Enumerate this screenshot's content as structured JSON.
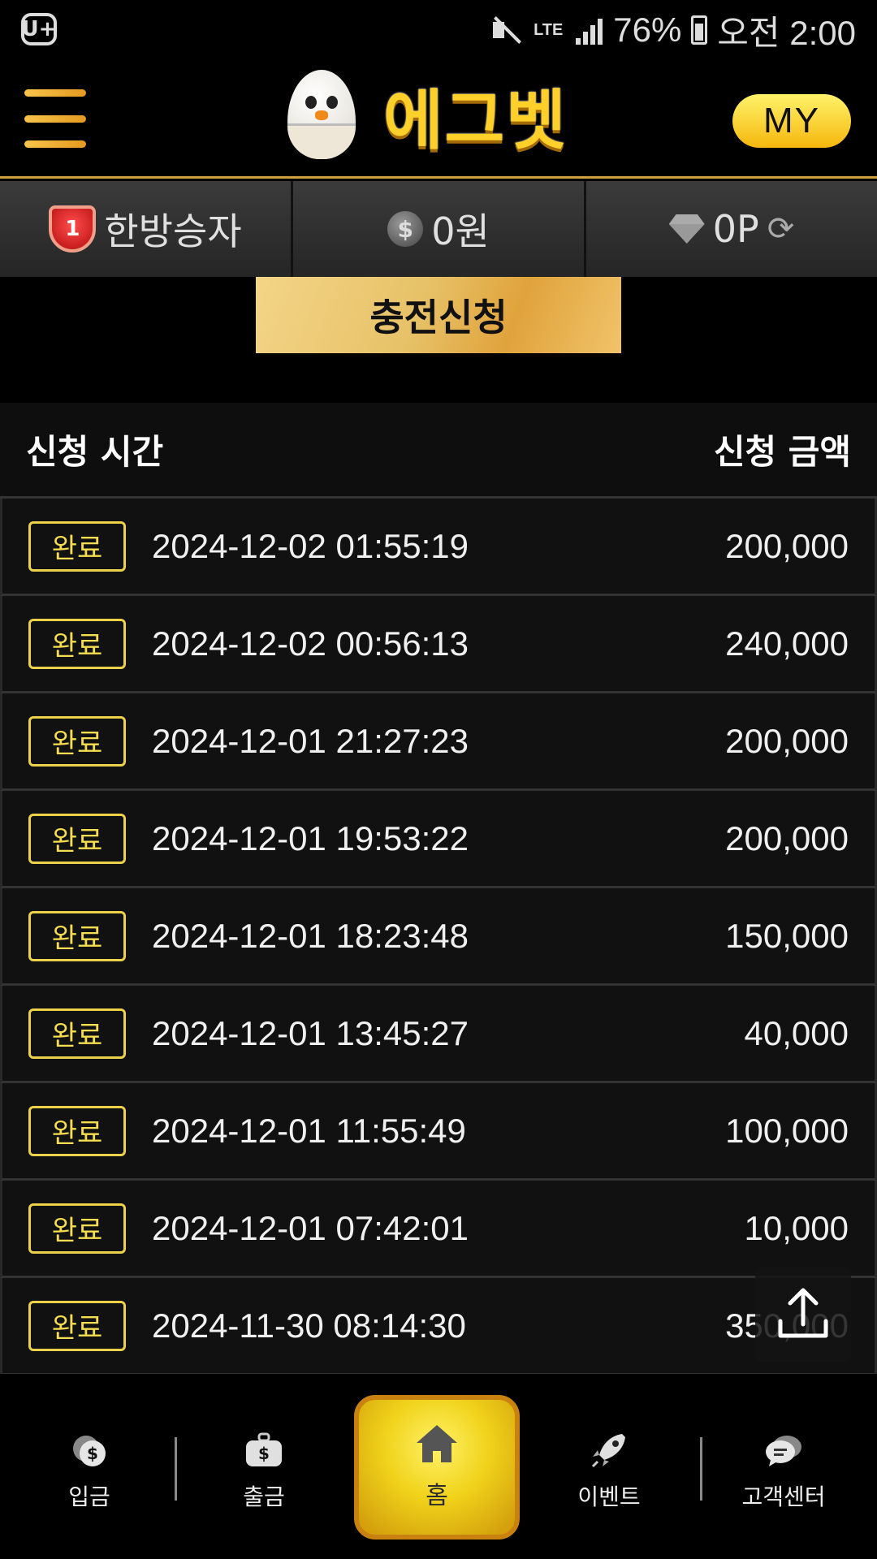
{
  "status_bar": {
    "carrier_icon": "U+",
    "network": "LTE",
    "battery": "76%",
    "time": "오전 2:00"
  },
  "header": {
    "logo_text": "에그벳",
    "my_button_label": "MY"
  },
  "info_bar": {
    "level": "1",
    "username": "한방승자",
    "balance": "0원",
    "points": "0P"
  },
  "charge_button_label": "충전신청",
  "table": {
    "col_time": "신청 시간",
    "col_amount": "신청 금액",
    "rows": [
      {
        "status": "완료",
        "time": "2024-12-02 01:55:19",
        "amount": "200,000"
      },
      {
        "status": "완료",
        "time": "2024-12-02 00:56:13",
        "amount": "240,000"
      },
      {
        "status": "완료",
        "time": "2024-12-01 21:27:23",
        "amount": "200,000"
      },
      {
        "status": "완료",
        "time": "2024-12-01 19:53:22",
        "amount": "200,000"
      },
      {
        "status": "완료",
        "time": "2024-12-01 18:23:48",
        "amount": "150,000"
      },
      {
        "status": "완료",
        "time": "2024-12-01 13:45:27",
        "amount": "40,000"
      },
      {
        "status": "완료",
        "time": "2024-12-01 11:55:49",
        "amount": "100,000"
      },
      {
        "status": "완료",
        "time": "2024-12-01 07:42:01",
        "amount": "10,000"
      },
      {
        "status": "완료",
        "time": "2024-11-30 08:14:30",
        "amount": "350,000"
      }
    ]
  },
  "bottom_nav": {
    "deposit": "입금",
    "withdraw": "출금",
    "home": "홈",
    "event": "이벤트",
    "support": "고객센터"
  },
  "colors": {
    "accent_gold": "#f5c518",
    "badge_yellow": "#ecd24a",
    "background": "#000000"
  }
}
